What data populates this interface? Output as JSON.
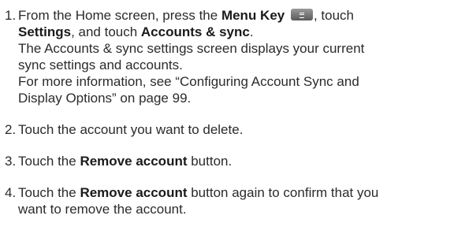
{
  "steps": [
    {
      "number": "1.",
      "line1_pre": "From the Home screen, press the ",
      "menu_key": "Menu Key",
      "menu_key_icon": "menu-key-icon",
      "line1_post": ", touch",
      "settings": "Settings",
      "and_touch": ", and touch ",
      "accounts_sync": "Accounts & sync",
      "period": ".",
      "note1": "The Accounts & sync settings screen displays your current sync settings and accounts.",
      "note2": "For more information, see “Configuring Account Sync and Display Options” on page 99."
    },
    {
      "number": "2.",
      "text": "Touch the account you want to delete."
    },
    {
      "number": "3.",
      "pre": "Touch the ",
      "bold": "Remove account",
      "post": " button."
    },
    {
      "number": "4.",
      "pre": "Touch the ",
      "bold": "Remove account",
      "post": " button again to confirm that you want to remove the account."
    }
  ]
}
